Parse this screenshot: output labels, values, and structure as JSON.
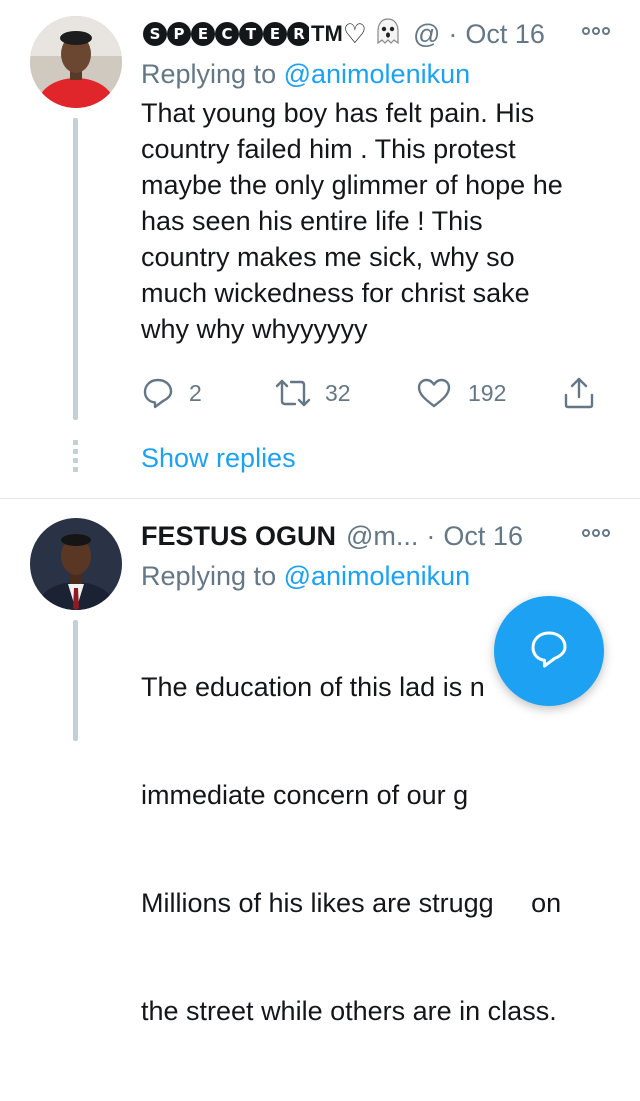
{
  "tweets": [
    {
      "name": "SPECTER",
      "name_suffix": "TM",
      "heart": "♡",
      "handle": "@",
      "date": "Oct 16",
      "reply_prefix": "Replying to",
      "reply_handle": "@animolenikun",
      "text_lines": [
        "That young boy has felt pain. His",
        "country failed him . This protest",
        "maybe the only glimmer of hope he",
        "has seen his entire life ! This",
        "country makes me sick, why so",
        "much wickedness for christ sake",
        "why why whyyyyyy"
      ],
      "replies": "2",
      "retweets": "32",
      "likes": "192"
    },
    {
      "name": "FESTUS OGUN",
      "handle": "@m...",
      "date": "Oct 16",
      "reply_prefix": "Replying to",
      "reply_handle": "@animolenikun",
      "text_lines": [
        "The education of this lad is n",
        "immediate concern of our g",
        "Millions of his likes are strugg     on",
        "the street while others are in class."
      ]
    }
  ],
  "show_replies": "Show replies",
  "icons": {
    "reply": "reply-icon",
    "retweet": "retweet-icon",
    "like": "heart-icon",
    "share": "share-icon",
    "more": "more-icon",
    "compose": "compose-reply-icon"
  },
  "colors": {
    "accent": "#1da1f2",
    "secondary_text": "#657786",
    "text": "#14171a",
    "thread_line": "#c4cfd6"
  }
}
